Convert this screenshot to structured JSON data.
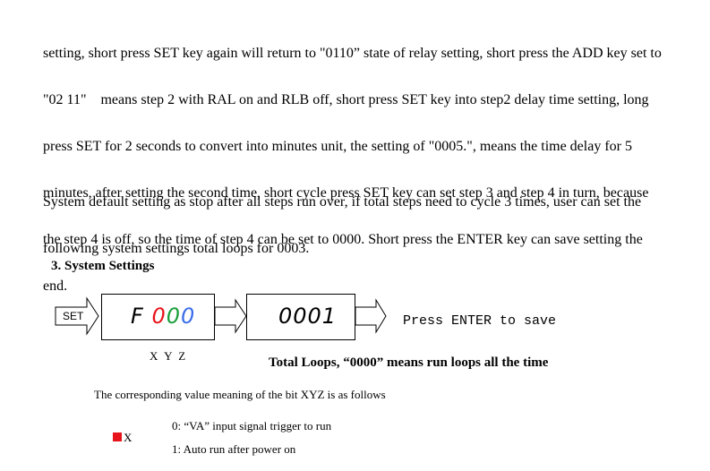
{
  "paragraph1": [
    "setting, short press SET key again will return to \"0110” state of relay setting, short press the ADD key set to",
    "\"02 11\"    means step 2 with RAL on and RLB off, short press SET key into step2 delay time setting, long",
    "press SET for 2 seconds to convert into minutes unit, the setting of \"0005.\", means the time delay for 5",
    "minutes, after setting the second time, short cycle press SET key can set step 3 and step 4 in turn, because",
    "the step 4 is off, so the time of step 4 can be set to 0000. Short press the ENTER key can save setting the",
    "end."
  ],
  "paragraph2": [
    "System default setting as stop after all steps run over, if total steps need to cycle 3 times, user can set the",
    "following system settings total loops for 0003."
  ],
  "section_title": "3. System Settings",
  "diagram": {
    "set_label": "SET",
    "display1_prefix": "F",
    "display1_digits": [
      "0",
      "0",
      "0"
    ],
    "digit_colors": [
      "#e8141b",
      "#1a9e3a",
      "#3a6ee8"
    ],
    "display2": "0001",
    "press_enter": "Press ENTER to save",
    "xyz_label": "X Y Z",
    "total_loops": "Total Loops, “0000” means run loops all the time"
  },
  "bit_intro": "The corresponding value meaning of the bit XYZ is as follows",
  "bit_x": {
    "label": "X",
    "marker_color": "#e8141b",
    "options": [
      "0: “VA” input signal trigger to run",
      "1: Auto run after power on"
    ]
  }
}
